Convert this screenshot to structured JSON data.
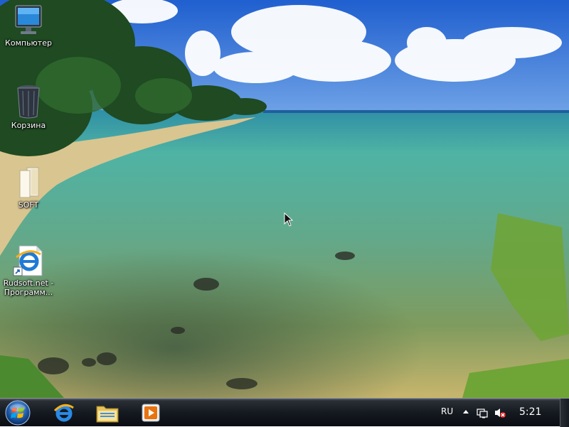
{
  "desktop": {
    "icons": [
      {
        "label": "Компьютер",
        "icon": "computer-icon"
      },
      {
        "label": "Корзина",
        "icon": "recycle-bin-icon"
      },
      {
        "label": "SOFT",
        "icon": "folder-icon"
      },
      {
        "label_line1": "Rudsoft.net -",
        "label_line2": "Программ...",
        "icon": "internet-explorer-shortcut-icon"
      }
    ]
  },
  "taskbar": {
    "start": {
      "icon": "windows-start-orb-icon"
    },
    "pinned": [
      {
        "icon": "internet-explorer-icon"
      },
      {
        "icon": "windows-explorer-folder-icon"
      },
      {
        "icon": "media-player-icon"
      }
    ],
    "tray": {
      "language": "RU",
      "clock": "5:21",
      "icons": [
        "show-hidden-icons-arrow",
        "network-icon",
        "volume-muted-icon"
      ]
    }
  },
  "colors": {
    "sky": "#2f6ed6",
    "sea": "#5fb89f",
    "sand": "#d8c27a",
    "taskbar": "#151a20"
  }
}
